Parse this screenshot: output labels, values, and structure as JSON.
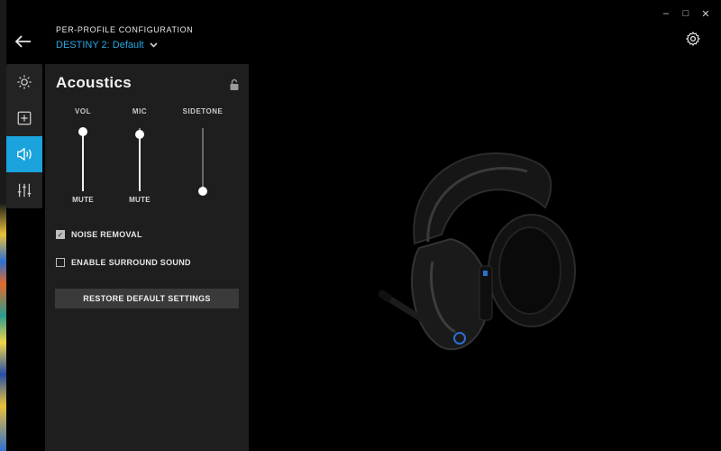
{
  "header": {
    "title": "PER-PROFILE CONFIGURATION",
    "profile": "DESTINY 2: Default"
  },
  "window_controls": {
    "minimize": "–",
    "maximize": "□",
    "close": "✕"
  },
  "tabs": [
    {
      "icon": "sun-icon"
    },
    {
      "icon": "plus-box-icon"
    },
    {
      "icon": "speaker-icon",
      "active": true
    },
    {
      "icon": "equalizer-icon"
    }
  ],
  "panel": {
    "title": "Acoustics",
    "sliders": [
      {
        "label": "VOL",
        "mute_label": "MUTE",
        "level": 0.95
      },
      {
        "label": "MIC",
        "mute_label": "MUTE",
        "level": 0.9
      },
      {
        "label": "SIDETONE",
        "mute_label": "",
        "level": 0.0
      }
    ],
    "checkboxes": [
      {
        "label": "NOISE REMOVAL",
        "checked": true
      },
      {
        "label": "ENABLE SURROUND SOUND",
        "checked": false
      }
    ],
    "restore_button": "RESTORE DEFAULT SETTINGS"
  },
  "colors": {
    "accent": "#1aa3dc",
    "profile_text": "#2aa8e6",
    "panel_bg": "#1e1e1e",
    "button_bg": "#3a3a3a"
  }
}
